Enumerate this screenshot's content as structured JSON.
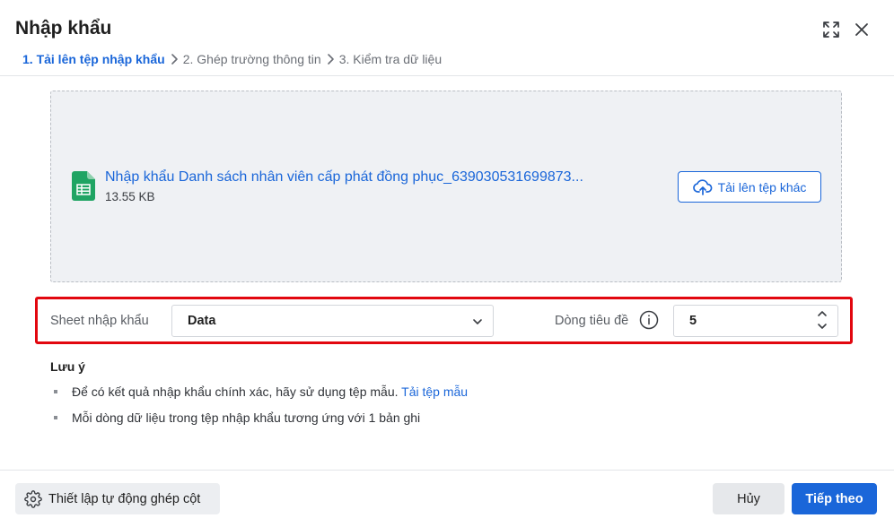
{
  "dialog": {
    "title": "Nhập khẩu"
  },
  "steps": [
    {
      "label": "1. Tải lên tệp nhập khẩu"
    },
    {
      "label": "2. Ghép trường thông tin"
    },
    {
      "label": "3. Kiểm tra dữ liệu"
    }
  ],
  "file": {
    "name": "Nhập khẩu Danh sách nhân viên cấp phát đồng phục_639030531699873...",
    "size": "13.55 KB",
    "upload_other_label": "Tải lên tệp khác"
  },
  "options": {
    "sheet_label": "Sheet nhập khẩu",
    "sheet_value": "Data",
    "header_row_label": "Dòng tiêu đề",
    "header_row_value": "5"
  },
  "notes": {
    "title": "Lưu ý",
    "item1_text": "Để có kết quả nhập khẩu chính xác, hãy sử dụng tệp mẫu. ",
    "item1_link": "Tải tệp mẫu",
    "item2_text": "Mỗi dòng dữ liệu trong tệp nhập khẩu tương ứng với 1 bản ghi"
  },
  "footer": {
    "auto_map_label": "Thiết lập tự động ghép cột",
    "cancel_label": "Hủy",
    "next_label": "Tiếp theo"
  },
  "icons": {
    "expand": "expand-icon",
    "close": "close-icon",
    "file": "spreadsheet-file-icon",
    "upload": "cloud-upload-icon",
    "info": "info-icon",
    "gear": "gear-icon"
  },
  "colors": {
    "accent": "#1a66d9",
    "highlight_border": "#e2070f",
    "file_green": "#1fa463"
  }
}
